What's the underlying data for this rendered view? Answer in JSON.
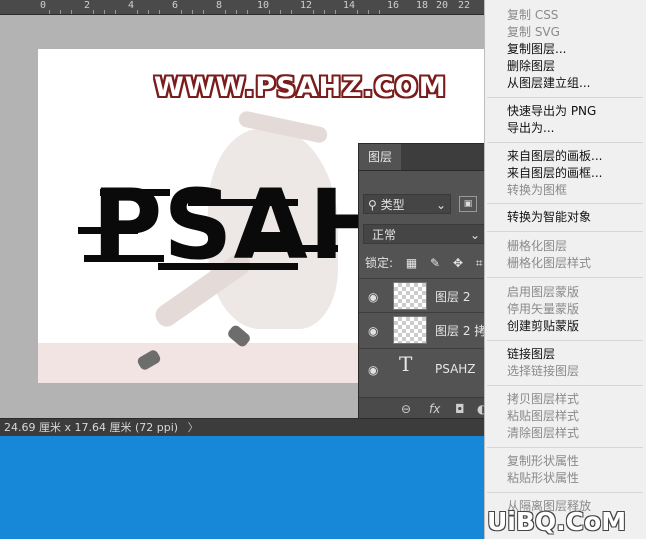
{
  "ruler": {
    "labels": [
      "0",
      "2",
      "4",
      "6",
      "8",
      "10",
      "12",
      "14",
      "16",
      "18",
      "20",
      "22"
    ]
  },
  "canvas": {
    "watermark": "WWW.PSAHZ.COM",
    "big_text": "PSAHZ"
  },
  "statusbar": {
    "text": "24.69 厘米 x 17.64 厘米 (72 ppi)",
    "arrow": "〉"
  },
  "layers_panel": {
    "tab": "图层",
    "filter_label": "类型",
    "blend_mode": "正常",
    "lock_label": "锁定:",
    "layers": [
      {
        "name": "图层 2",
        "kind": "pixel"
      },
      {
        "name": "图层 2 拷",
        "kind": "pixel"
      },
      {
        "name": "PSAHZ",
        "kind": "text"
      }
    ],
    "footer": {
      "link": "⊖",
      "fx": "fx",
      "mask": "◘"
    }
  },
  "menu": {
    "items": [
      {
        "label": "复制 CSS",
        "enabled": false
      },
      {
        "label": "复制 SVG",
        "enabled": false
      },
      {
        "label": "复制图层...",
        "enabled": true
      },
      {
        "label": "删除图层",
        "enabled": true
      },
      {
        "label": "从图层建立组...",
        "enabled": true
      },
      {
        "label": "快速导出为 PNG",
        "enabled": true
      },
      {
        "label": "导出为...",
        "enabled": true
      },
      {
        "label": "来自图层的画板...",
        "enabled": true
      },
      {
        "label": "来自图层的画框...",
        "enabled": true
      },
      {
        "label": "转换为图框",
        "enabled": false
      },
      {
        "label": "转换为智能对象",
        "enabled": true
      },
      {
        "label": "栅格化图层",
        "enabled": false
      },
      {
        "label": "栅格化图层样式",
        "enabled": false
      },
      {
        "label": "启用图层蒙版",
        "enabled": false
      },
      {
        "label": "停用矢量蒙版",
        "enabled": false
      },
      {
        "label": "创建剪贴蒙版",
        "enabled": true
      },
      {
        "label": "链接图层",
        "enabled": true
      },
      {
        "label": "选择链接图层",
        "enabled": false
      },
      {
        "label": "拷贝图层样式",
        "enabled": false
      },
      {
        "label": "粘贴图层样式",
        "enabled": false
      },
      {
        "label": "清除图层样式",
        "enabled": false
      },
      {
        "label": "复制形状属性",
        "enabled": false
      },
      {
        "label": "粘贴形状属性",
        "enabled": false
      },
      {
        "label": "从隔离图层释放",
        "enabled": false
      }
    ]
  },
  "watermark_logo": "UiBQ.CoM",
  "colors": {
    "menu_bg": "#f0f0f0",
    "panel_bg": "#535353",
    "desktop": "#1788d8",
    "watermark_stroke": "#7a1c1c"
  }
}
